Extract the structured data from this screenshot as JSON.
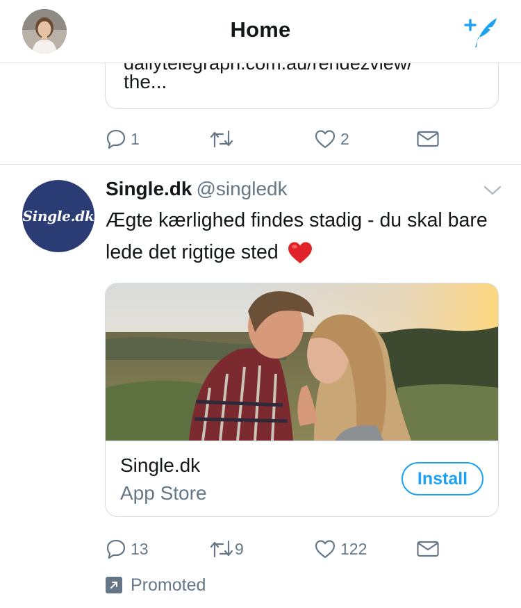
{
  "header": {
    "title": "Home",
    "avatar_icon": "user-avatar",
    "compose_icon": "compose-tweet-icon",
    "accent": "#1da1f2"
  },
  "previous_tweet": {
    "card_clipped_text": "dailytelegraph.com.au/rendezview/",
    "card_trailing_text": "the...",
    "actions": {
      "reply_count": "1",
      "retweet_count": "",
      "like_count": "2"
    }
  },
  "promoted_tweet": {
    "brand_avatar_text": "Single.dk",
    "name": "Single.dk",
    "handle": "@singledk",
    "text": "Ægte kærlighed findes stadig - du skal bare lede det rigtige sted",
    "emoji": "red-heart",
    "card": {
      "app_name": "Single.dk",
      "store": "App Store",
      "install_label": "Install"
    },
    "actions": {
      "reply_count": "13",
      "retweet_count": "9",
      "like_count": "122"
    },
    "promoted_label": "Promoted"
  },
  "colors": {
    "text": "#14171a",
    "secondary": "#657786",
    "border": "#d5dde3",
    "brand_avatar_bg": "#2b3b74"
  }
}
